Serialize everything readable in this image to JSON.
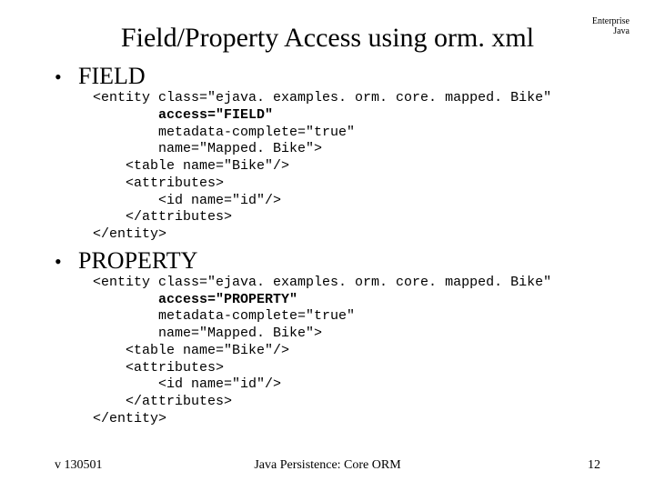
{
  "header": {
    "line1": "Enterprise",
    "line2": "Java"
  },
  "title": "Field/Property Access using orm. xml",
  "sections": [
    {
      "label": "FIELD",
      "code_lines": [
        {
          "text": "<entity class=\"ejava. examples. orm. core. mapped. Bike\"",
          "bold": false
        },
        {
          "text": "        access=\"FIELD\"",
          "bold": true
        },
        {
          "text": "        metadata-complete=\"true\"",
          "bold": false
        },
        {
          "text": "        name=\"Mapped. Bike\">",
          "bold": false
        },
        {
          "text": "    <table name=\"Bike\"/>",
          "bold": false
        },
        {
          "text": "    <attributes>",
          "bold": false
        },
        {
          "text": "        <id name=\"id\"/>",
          "bold": false
        },
        {
          "text": "    </attributes>",
          "bold": false
        },
        {
          "text": "</entity>",
          "bold": false
        }
      ]
    },
    {
      "label": "PROPERTY",
      "code_lines": [
        {
          "text": "<entity class=\"ejava. examples. orm. core. mapped. Bike\"",
          "bold": false
        },
        {
          "text": "        access=\"PROPERTY\"",
          "bold": true
        },
        {
          "text": "        metadata-complete=\"true\"",
          "bold": false
        },
        {
          "text": "        name=\"Mapped. Bike\">",
          "bold": false
        },
        {
          "text": "    <table name=\"Bike\"/>",
          "bold": false
        },
        {
          "text": "    <attributes>",
          "bold": false
        },
        {
          "text": "        <id name=\"id\"/>",
          "bold": false
        },
        {
          "text": "    </attributes>",
          "bold": false
        },
        {
          "text": "</entity>",
          "bold": false
        }
      ]
    }
  ],
  "footer": {
    "left": "v 130501",
    "center": "Java Persistence: Core ORM",
    "right": "12"
  }
}
